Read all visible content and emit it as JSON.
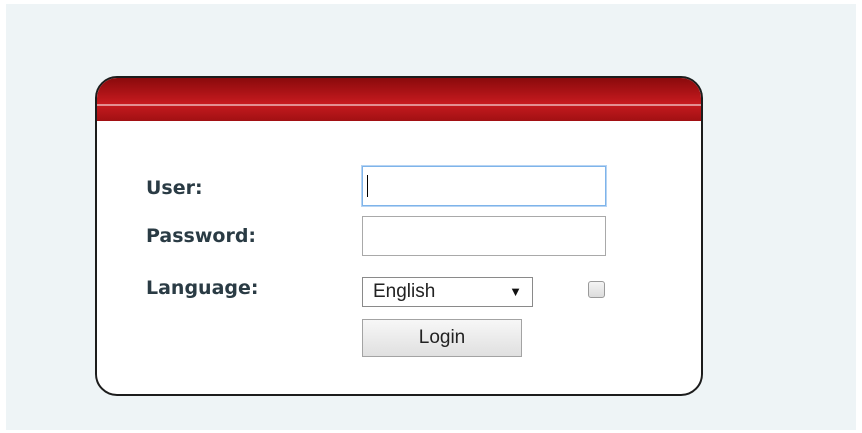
{
  "login_form": {
    "user_label": "User:",
    "password_label": "Password:",
    "language_label": "Language:",
    "user_value": "",
    "password_value": "",
    "language_selected": "English",
    "language_arrow": "▼",
    "login_button_label": "Login",
    "remember_checked": false
  },
  "colors": {
    "header_red": "#b8161a",
    "page_background": "#eef4f6",
    "label_text": "#2a3b44",
    "focus_border": "#7eb4ea"
  },
  "icons": {
    "dropdown": "triangle-down-icon"
  }
}
